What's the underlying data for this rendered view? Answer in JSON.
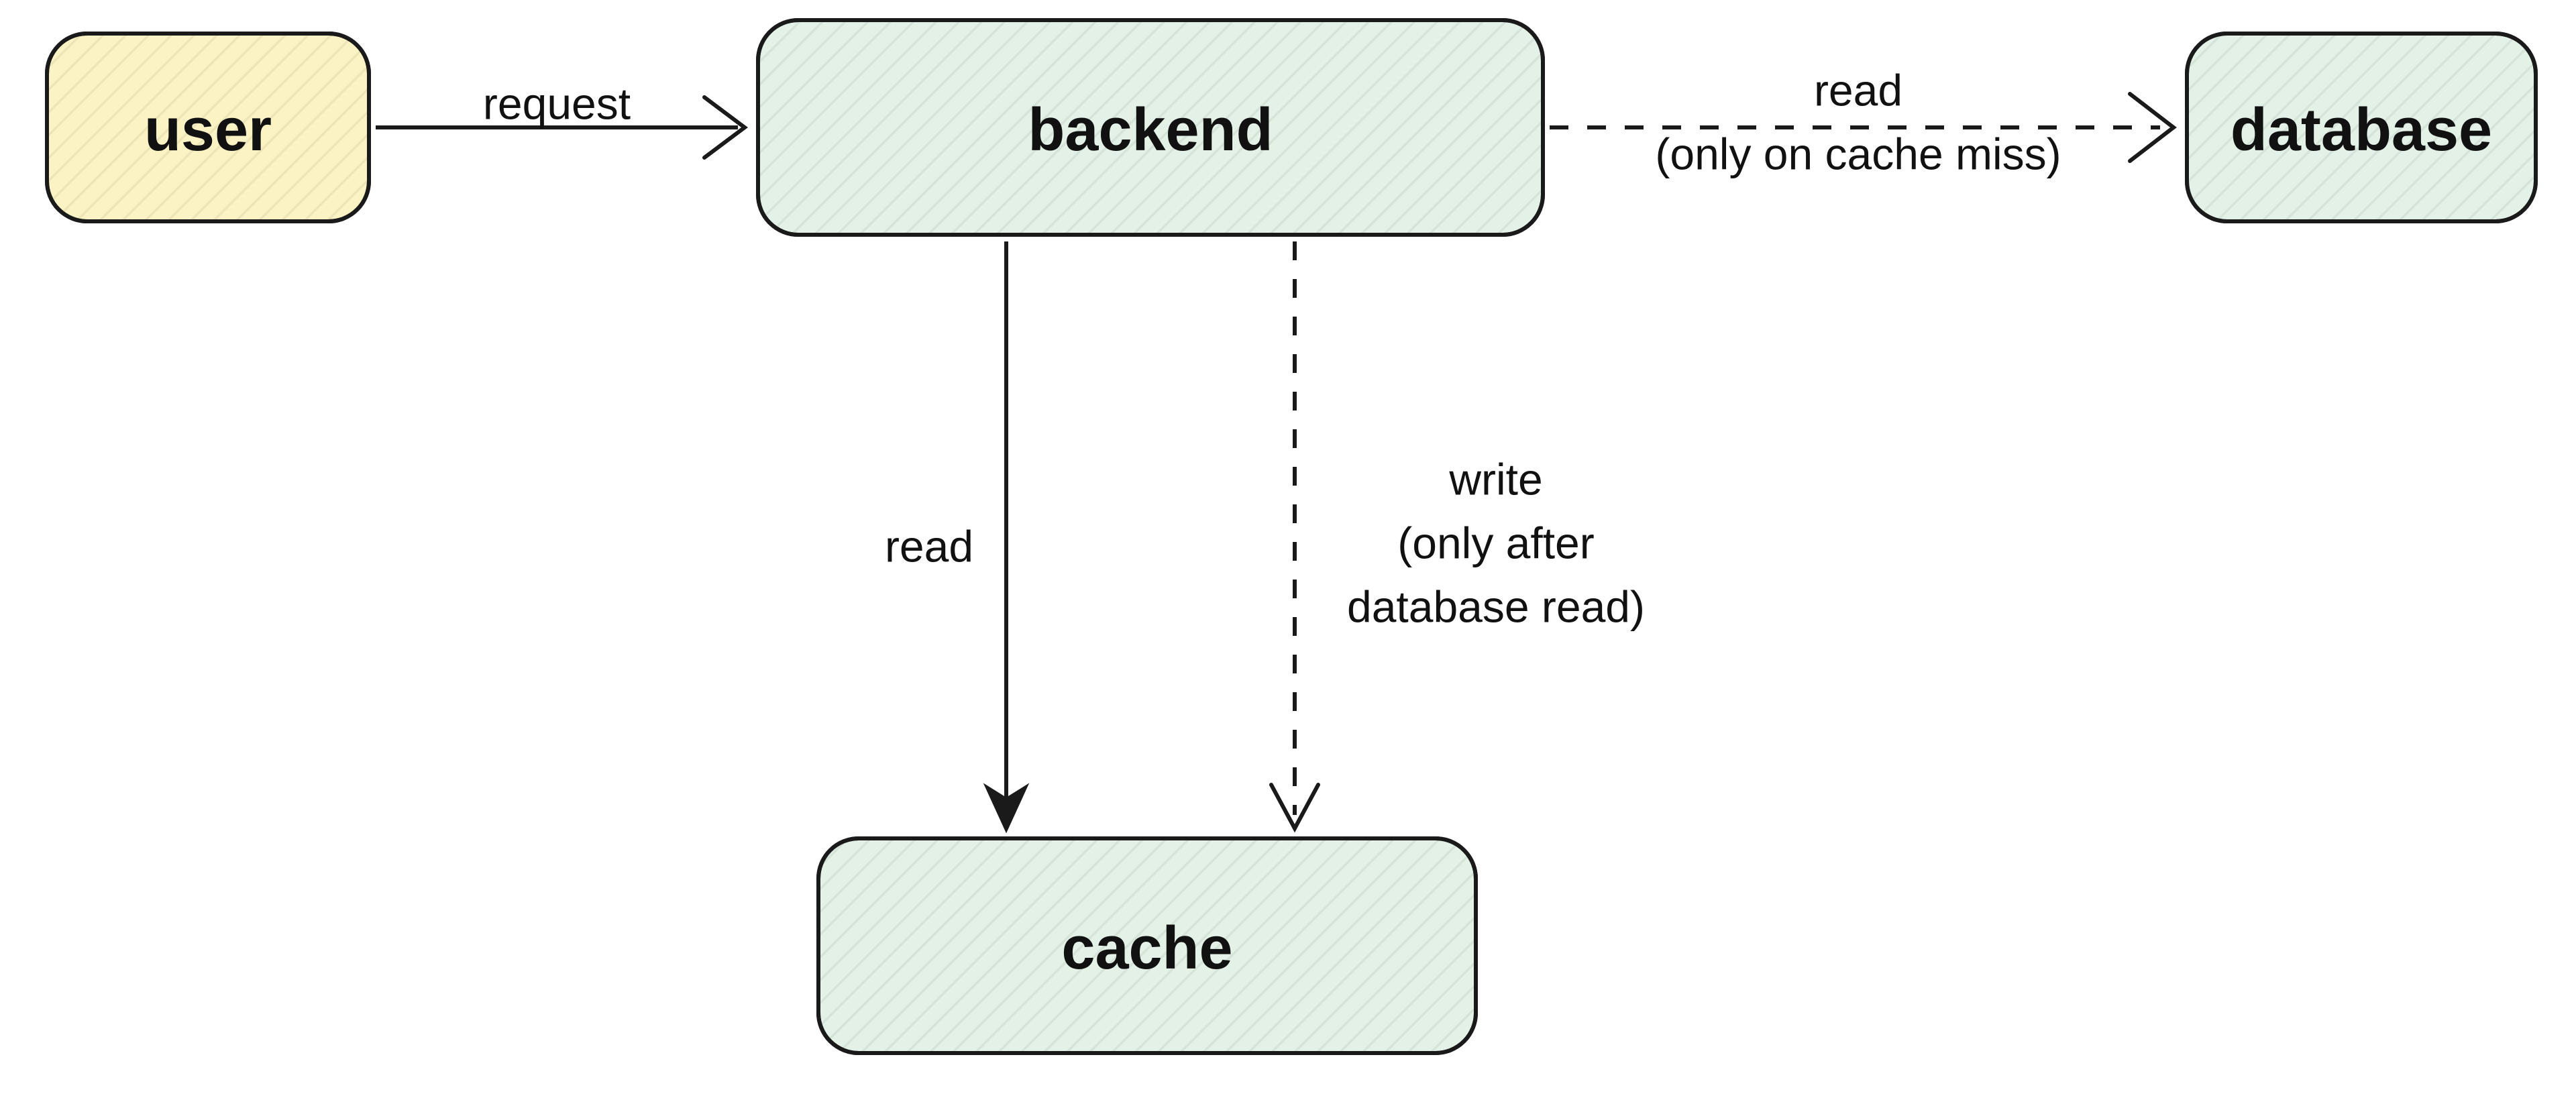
{
  "nodes": {
    "user": {
      "label": "user",
      "color": "yellow"
    },
    "backend": {
      "label": "backend",
      "color": "green"
    },
    "database": {
      "label": "database",
      "color": "green"
    },
    "cache": {
      "label": "cache",
      "color": "green"
    }
  },
  "edges": {
    "user_backend": {
      "label": "request",
      "style": "solid"
    },
    "backend_database": {
      "label_line1": "read",
      "label_line2": "(only on cache miss)",
      "style": "dashed"
    },
    "backend_cache_read": {
      "label": "read",
      "style": "solid"
    },
    "backend_cache_write": {
      "label_line1": "write",
      "label_line2": "(only after",
      "label_line3": "database read)",
      "style": "dashed"
    }
  }
}
